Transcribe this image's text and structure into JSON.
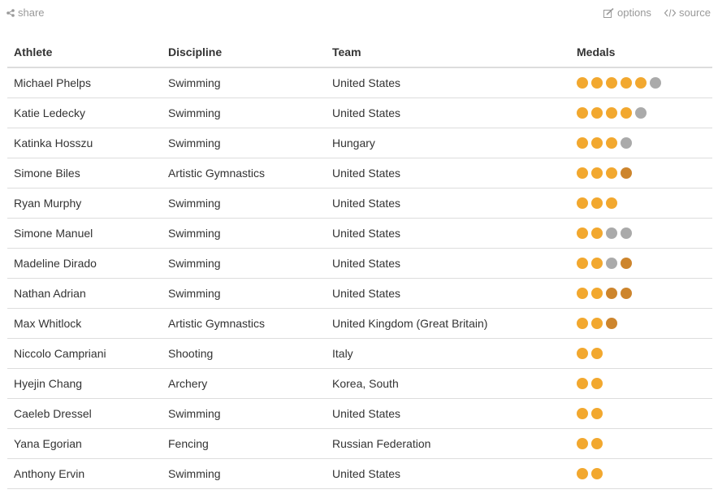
{
  "toolbar": {
    "share_label": "share",
    "options_label": "options",
    "source_label": "source"
  },
  "table": {
    "headers": [
      "Athlete",
      "Discipline",
      "Team",
      "Medals"
    ],
    "rows": [
      {
        "athlete": "Michael Phelps",
        "discipline": "Swimming",
        "team": "United States",
        "medals": {
          "gold": 5,
          "silver": 1,
          "bronze": 0
        }
      },
      {
        "athlete": "Katie Ledecky",
        "discipline": "Swimming",
        "team": "United States",
        "medals": {
          "gold": 4,
          "silver": 1,
          "bronze": 0
        }
      },
      {
        "athlete": "Katinka Hosszu",
        "discipline": "Swimming",
        "team": "Hungary",
        "medals": {
          "gold": 3,
          "silver": 1,
          "bronze": 0
        }
      },
      {
        "athlete": "Simone Biles",
        "discipline": "Artistic Gymnastics",
        "team": "United States",
        "medals": {
          "gold": 3,
          "silver": 0,
          "bronze": 1
        }
      },
      {
        "athlete": "Ryan Murphy",
        "discipline": "Swimming",
        "team": "United States",
        "medals": {
          "gold": 3,
          "silver": 0,
          "bronze": 0
        }
      },
      {
        "athlete": "Simone Manuel",
        "discipline": "Swimming",
        "team": "United States",
        "medals": {
          "gold": 2,
          "silver": 2,
          "bronze": 0
        }
      },
      {
        "athlete": "Madeline Dirado",
        "discipline": "Swimming",
        "team": "United States",
        "medals": {
          "gold": 2,
          "silver": 1,
          "bronze": 1
        }
      },
      {
        "athlete": "Nathan Adrian",
        "discipline": "Swimming",
        "team": "United States",
        "medals": {
          "gold": 2,
          "silver": 0,
          "bronze": 2
        }
      },
      {
        "athlete": "Max Whitlock",
        "discipline": "Artistic Gymnastics",
        "team": "United Kingdom (Great Britain)",
        "medals": {
          "gold": 2,
          "silver": 0,
          "bronze": 1
        }
      },
      {
        "athlete": "Niccolo Campriani",
        "discipline": "Shooting",
        "team": "Italy",
        "medals": {
          "gold": 2,
          "silver": 0,
          "bronze": 0
        }
      },
      {
        "athlete": "Hyejin Chang",
        "discipline": "Archery",
        "team": "Korea, South",
        "medals": {
          "gold": 2,
          "silver": 0,
          "bronze": 0
        }
      },
      {
        "athlete": "Caeleb Dressel",
        "discipline": "Swimming",
        "team": "United States",
        "medals": {
          "gold": 2,
          "silver": 0,
          "bronze": 0
        }
      },
      {
        "athlete": "Yana Egorian",
        "discipline": "Fencing",
        "team": "Russian Federation",
        "medals": {
          "gold": 2,
          "silver": 0,
          "bronze": 0
        }
      },
      {
        "athlete": "Anthony Ervin",
        "discipline": "Swimming",
        "team": "United States",
        "medals": {
          "gold": 2,
          "silver": 0,
          "bronze": 0
        }
      }
    ]
  },
  "colors": {
    "gold": "#f2a82f",
    "silver": "#aaaaaa",
    "bronze": "#cd852d"
  },
  "icons": {
    "share": "share-icon",
    "options": "edit-icon",
    "source": "code-icon"
  }
}
